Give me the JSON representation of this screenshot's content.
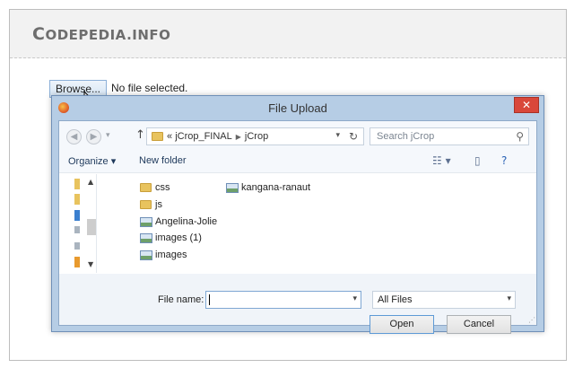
{
  "site": {
    "title_first": "C",
    "title_rest_small": "ODEPEDIA",
    "title_suffix": ".INFO"
  },
  "page": {
    "browse_label": "Browse...",
    "file_status": "No file selected."
  },
  "dialog": {
    "title": "File Upload",
    "close_label": "✕",
    "address": {
      "prefix": "«",
      "segments": [
        "jCrop_FINAL",
        "jCrop"
      ]
    },
    "search_placeholder": "Search jCrop",
    "toolbar": {
      "organize": "Organize ▾",
      "new_folder": "New folder"
    },
    "files_col1": [
      {
        "name": "css",
        "type": "folder"
      },
      {
        "name": "js",
        "type": "folder"
      },
      {
        "name": "Angelina-Jolie",
        "type": "image"
      },
      {
        "name": "images (1)",
        "type": "image"
      },
      {
        "name": "images",
        "type": "image"
      }
    ],
    "files_col2": [
      {
        "name": "kangana-ranaut",
        "type": "image"
      }
    ],
    "file_name_label": "File name:",
    "file_name_value": "",
    "file_type": "All Files",
    "open_label": "Open",
    "cancel_label": "Cancel"
  },
  "colors": {
    "dialog_frame": "#b6cde5",
    "close_red": "#d9473a",
    "folder_yellow": "#e8c35e",
    "link_blue": "#1e395b"
  }
}
